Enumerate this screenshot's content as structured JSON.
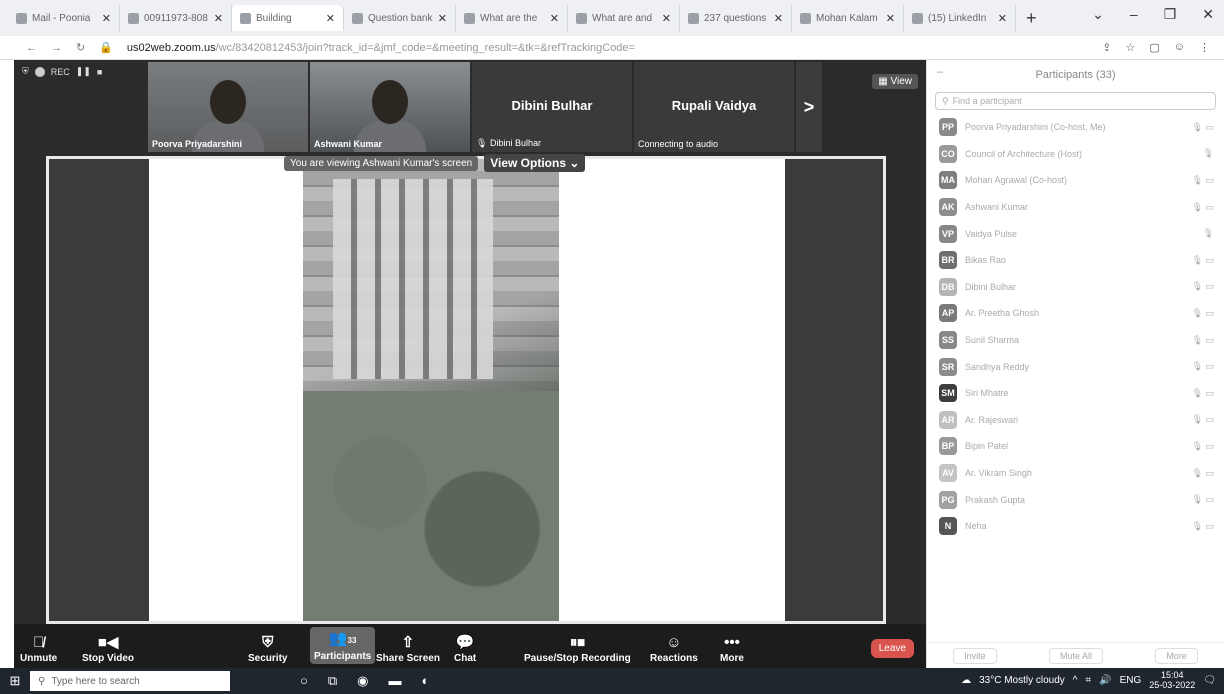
{
  "browser": {
    "tabs": [
      {
        "title": "Mail - Poonia",
        "active": false
      },
      {
        "title": "00911973-808",
        "active": false
      },
      {
        "title": "Building",
        "active": true
      },
      {
        "title": "Question bank",
        "active": false
      },
      {
        "title": "What are the",
        "active": false
      },
      {
        "title": "What are and",
        "active": false
      },
      {
        "title": "237 questions",
        "active": false
      },
      {
        "title": "Mohan Kalam",
        "active": false
      },
      {
        "title": "(15) LinkedIn",
        "active": false
      }
    ],
    "new_tab": "+",
    "url_domain": "us02web.zoom.us",
    "url_rest": "/wc/83420812453/join?track_id=&jmf_code=&meeting_result=&tk=&refTrackingCode="
  },
  "meeting": {
    "rec_label": "REC",
    "view_label": "View",
    "thumbs": [
      {
        "name": "Poorva Priyadarshini",
        "type": "video"
      },
      {
        "name": "Ashwani Kumar",
        "type": "video"
      },
      {
        "name": "Dibini Bulhar",
        "center": "Dibini Bulhar",
        "type": "name"
      },
      {
        "name": "Connecting to audio",
        "center": "Rupali Vaidya",
        "type": "name"
      }
    ],
    "next_label": ">",
    "share_msg": "You are viewing Ashwani Kumar's screen",
    "view_options": "View Options",
    "toolbar": {
      "unmute": "Unmute",
      "stop_video": "Stop Video",
      "security": "Security",
      "participants": "Participants",
      "participants_count": "33",
      "share_screen": "Share Screen",
      "chat": "Chat",
      "recording": "Pause/Stop Recording",
      "reactions": "Reactions",
      "more": "More",
      "leave": "Leave"
    }
  },
  "participants_panel": {
    "title": "Participants (33)",
    "search_placeholder": "Find a participant",
    "participants": [
      {
        "initials": "PP",
        "name": "Poorva Priyadarshini (Co-host, Me)",
        "color": "#8a8a8a"
      },
      {
        "initials": "CO",
        "name": "Council of Architecture (Host)",
        "color": "#9a9a9a"
      },
      {
        "initials": "MA",
        "name": "Mohan Agrawal (Co-host)",
        "color": "#7e7e7e"
      },
      {
        "initials": "AK",
        "name": "Ashwani Kumar",
        "color": "#8d8d8d"
      },
      {
        "initials": "VP",
        "name": "Vaidya Pulse",
        "color": "#888888"
      },
      {
        "initials": "BR",
        "name": "Bikas Rao",
        "color": "#6f6f6f"
      },
      {
        "initials": "DB",
        "name": "Dibini Bulhar",
        "color": "#b5b5b5"
      },
      {
        "initials": "AP",
        "name": "Ar. Preetha Ghosh",
        "color": "#7a7a7a"
      },
      {
        "initials": "SS",
        "name": "Sunil Sharma",
        "color": "#888888"
      },
      {
        "initials": "SR",
        "name": "Sandhya Reddy",
        "color": "#8c8c8c"
      },
      {
        "initials": "SM",
        "name": "Siri Mhatre",
        "color": "#3d3d3d"
      },
      {
        "initials": "AR",
        "name": "Ar. Rajeswari",
        "color": "#bfbfbf"
      },
      {
        "initials": "BP",
        "name": "Bipin Patel",
        "color": "#9a9a9a"
      },
      {
        "initials": "AV",
        "name": "Ar. Vikram Singh",
        "color": "#c4c4c4"
      },
      {
        "initials": "PG",
        "name": "Prakash Gupta",
        "color": "#a0a0a0"
      },
      {
        "initials": "N",
        "name": "Neha",
        "color": "#555555"
      }
    ],
    "footer": {
      "invite": "Invite",
      "mute_all": "Mute All",
      "more": "More"
    }
  },
  "taskbar": {
    "search_placeholder": "Type here to search",
    "weather": "33°C Mostly cloudy",
    "lang": "ENG",
    "time": "15:04",
    "date": "25-03-2022"
  }
}
